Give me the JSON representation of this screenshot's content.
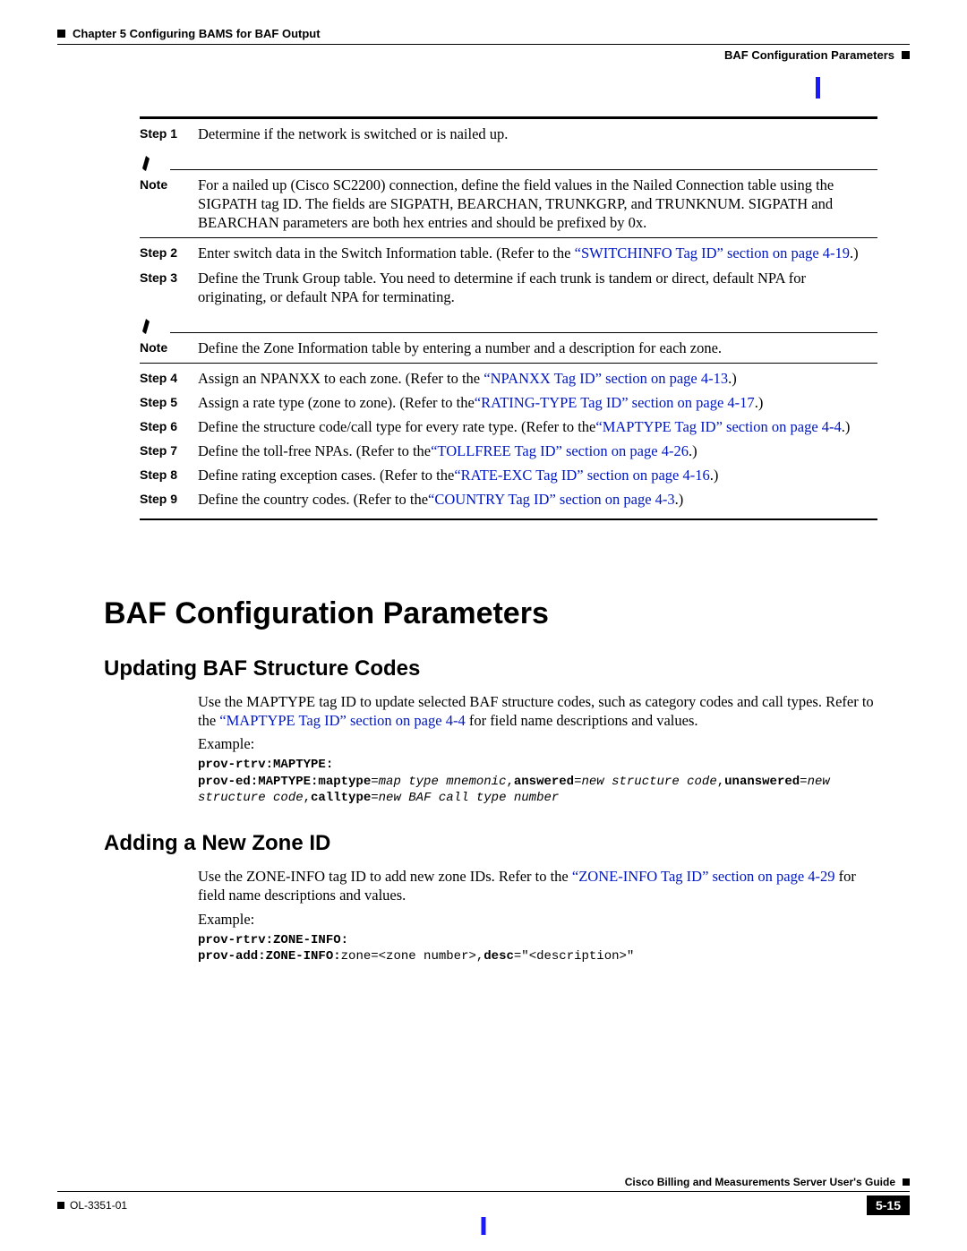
{
  "header": {
    "chapter": "Chapter 5      Configuring BAMS for BAF Output",
    "section": "BAF Configuration Parameters"
  },
  "steps": {
    "s1": {
      "label": "Step 1",
      "text": "Determine if the network is switched or is nailed up."
    },
    "s2": {
      "label": "Step 2",
      "prefix": "Enter switch data in the Switch Information table. (Refer to the ",
      "link": "“SWITCHINFO Tag ID” section on page 4-19",
      "suffix": ".)"
    },
    "s3": {
      "label": "Step 3",
      "text": "Define the Trunk Group table. You need to determine if each trunk is tandem or direct, default NPA for originating, or default NPA for terminating."
    },
    "s4": {
      "label": "Step 4",
      "prefix": "Assign an NPANXX to each zone. (Refer to the ",
      "link": "“NPANXX Tag ID” section on page 4-13",
      "suffix": ".)"
    },
    "s5": {
      "label": "Step 5",
      "prefix": "Assign a rate type (zone to zone). (Refer to the",
      "link": "“RATING-TYPE Tag ID” section on page 4-17",
      "suffix": ".)"
    },
    "s6": {
      "label": "Step 6",
      "prefix": "Define the structure code/call type for every rate type. (Refer to the",
      "link": "“MAPTYPE Tag ID” section on page 4-4",
      "suffix": ".)"
    },
    "s7": {
      "label": "Step 7",
      "prefix": "Define the toll-free NPAs. (Refer to the",
      "link": "“TOLLFREE Tag ID” section on page 4-26",
      "suffix": ".)"
    },
    "s8": {
      "label": "Step 8",
      "prefix": "Define rating exception cases. (Refer to the",
      "link": "“RATE-EXC Tag ID” section on page 4-16",
      "suffix": ".)"
    },
    "s9": {
      "label": "Step 9",
      "prefix": "Define the country codes. (Refer to the",
      "link": "“COUNTRY Tag ID” section on page 4-3",
      "suffix": ".)"
    }
  },
  "notes": {
    "n1": {
      "label": "Note",
      "text": "For a nailed up (Cisco SC2200) connection, define the field values in the Nailed Connection table using the SIGPATH tag ID. The fields are SIGPATH, BEARCHAN, TRUNKGRP, and TRUNKNUM. SIGPATH and BEARCHAN parameters are both hex entries and should be prefixed by 0x."
    },
    "n2": {
      "label": "Note",
      "text": "Define the Zone Information table by entering a number and a description for each zone."
    }
  },
  "headings": {
    "h1": "BAF Configuration Parameters",
    "h2a": "Updating BAF Structure Codes",
    "h2b": "Adding a New Zone ID"
  },
  "sectionA": {
    "p1_prefix": "Use the MAPTYPE tag ID to update selected BAF structure codes, such as category codes and call types. Refer to the ",
    "p1_link": "“MAPTYPE Tag ID” section on page 4-4",
    "p1_suffix": " for field name descriptions and values.",
    "example_label": "Example:",
    "code_bold1": "prov-rtrv:MAPTYPE:",
    "code_line2_a": "prov-ed:MAPTYPE:maptype",
    "code_line2_b": "map type mnemonic",
    "code_line2_c": "answered",
    "code_line2_d": "new structure code",
    "code_line2_e": "unanswered",
    "code_line2_f": "new structure code",
    "code_line2_g": "calltype",
    "code_line2_h": "new BAF call type number"
  },
  "sectionB": {
    "p1_prefix": "Use the ZONE-INFO tag ID to add new zone IDs. Refer to the ",
    "p1_link": "“ZONE-INFO Tag ID” section on page 4-29",
    "p1_suffix": " for field name descriptions and values.",
    "example_label": "Example:",
    "code_bold1": "prov-rtrv:ZONE-INFO:",
    "code_line2_a": "prov-add:ZONE-INFO:",
    "code_line2_b": "zone=<zone number>,",
    "code_line2_c": "desc",
    "code_line2_d": "=\"<description>\""
  },
  "footer": {
    "left": "OL-3351-01",
    "right_guide": "Cisco Billing and Measurements Server User's Guide",
    "page": "5-15"
  }
}
